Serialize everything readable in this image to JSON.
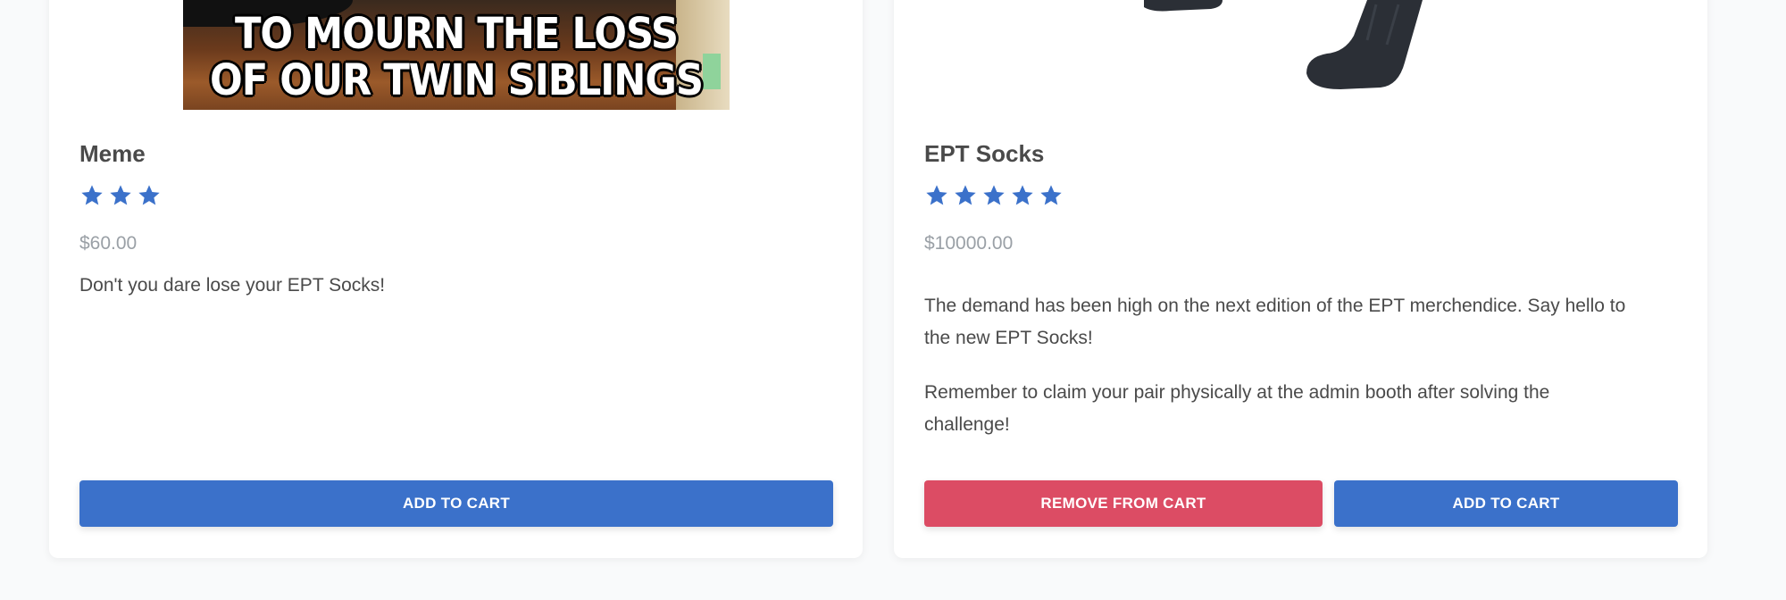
{
  "products": [
    {
      "name": "Meme",
      "rating": 3,
      "price": "$60.00",
      "image_caption": [
        "TO MOURN THE LOSS",
        "OF OUR TWIN SIBLINGS"
      ],
      "description": [
        "Don't you dare lose your EPT Socks!"
      ],
      "buttons": {
        "add": "ADD TO CART"
      }
    },
    {
      "name": "EPT Socks",
      "rating": 5,
      "price": "$10000.00",
      "description": [
        "The demand has been high on the next edition of the EPT merchendice. Say hello to the new EPT Socks!",
        "Remember to claim your pair physically at the admin booth after solving the challenge!"
      ],
      "buttons": {
        "remove": "REMOVE FROM CART",
        "add": "ADD TO CART"
      }
    }
  ],
  "colors": {
    "primary": "#3b71ca",
    "danger": "#dc4c64",
    "star": "#3b71ca",
    "price": "#9aa0a6"
  },
  "icons": {
    "rating": "star-icon"
  }
}
